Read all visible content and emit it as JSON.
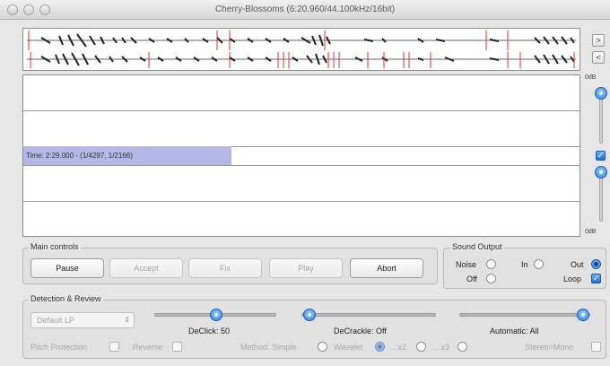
{
  "window": {
    "title": "Cherry-Blossoms (6:20.960/44.100kHz/16bit)"
  },
  "overview": {
    "next_label": ">",
    "prev_label": "<"
  },
  "lanes": {
    "time_text": "Time: 2:29.000 - (1/4297, 1/2166)"
  },
  "side": {
    "db_top": "0dB",
    "db_bottom": "0dB"
  },
  "main_controls": {
    "legend": "Main controls",
    "buttons": [
      {
        "label": "Pause",
        "enabled": true
      },
      {
        "label": "Accept",
        "enabled": false
      },
      {
        "label": "Fix",
        "enabled": false
      },
      {
        "label": "Play",
        "enabled": false
      },
      {
        "label": "Abort",
        "enabled": true
      }
    ]
  },
  "sound_output": {
    "legend": "Sound Output",
    "noise": "Noise",
    "in": "In",
    "out": "Out",
    "off": "Off",
    "loop": "Loop",
    "selected": "Out",
    "loop_checked": true
  },
  "detection": {
    "legend": "Detection & Review",
    "preset": "Default LP",
    "declick_label": "DeClick: 50",
    "decrackle_label": "DeCrackle: Off",
    "automatic_label": "Automatic: All",
    "pitch_protection": "Pitch Protection",
    "reverse": "Reverse",
    "method_label": "Method: Simple",
    "wavelet": "Wavelet",
    "x2": "...x2",
    "x3": "...x3",
    "stereo_mono": "Stereo>Mono"
  },
  "colors": {
    "accent": "#2a7fe0",
    "selection": "#b4b8e6",
    "marker": "#e03030"
  }
}
